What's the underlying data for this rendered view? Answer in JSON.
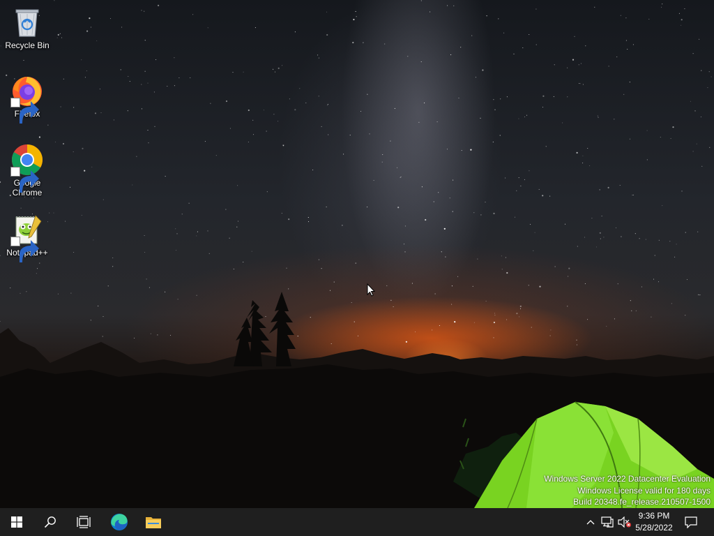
{
  "desktop": {
    "icons": [
      {
        "label": "Recycle Bin",
        "icon": "recycle-bin-icon"
      },
      {
        "label": "Firefox",
        "icon": "firefox-icon"
      },
      {
        "label": "Google Chrome",
        "icon": "chrome-icon"
      },
      {
        "label": "Notepad++",
        "icon": "notepad-plus-plus-icon"
      }
    ],
    "watermark": {
      "line1": "Windows Server 2022 Datacenter Evaluation",
      "line2": "Windows License valid for 180 days",
      "line3": "Build 20348.fe_release.210507-1500"
    }
  },
  "taskbar": {
    "buttons": [
      {
        "name": "Start",
        "icon": "windows-logo-icon"
      },
      {
        "name": "Search",
        "icon": "search-icon"
      },
      {
        "name": "Task View",
        "icon": "task-view-icon"
      },
      {
        "name": "Microsoft Edge",
        "icon": "edge-icon"
      },
      {
        "name": "File Explorer",
        "icon": "folder-icon"
      }
    ],
    "tray": {
      "icons": [
        "chevron-up-icon",
        "network-icon",
        "volume-muted-icon",
        "notification-icon"
      ],
      "time": "9:36 PM",
      "date": "5/28/2022"
    }
  },
  "colors": {
    "taskbar": "#1f1f1f",
    "tent": "#7fd81f",
    "horizon_glow": "#e8651a"
  }
}
